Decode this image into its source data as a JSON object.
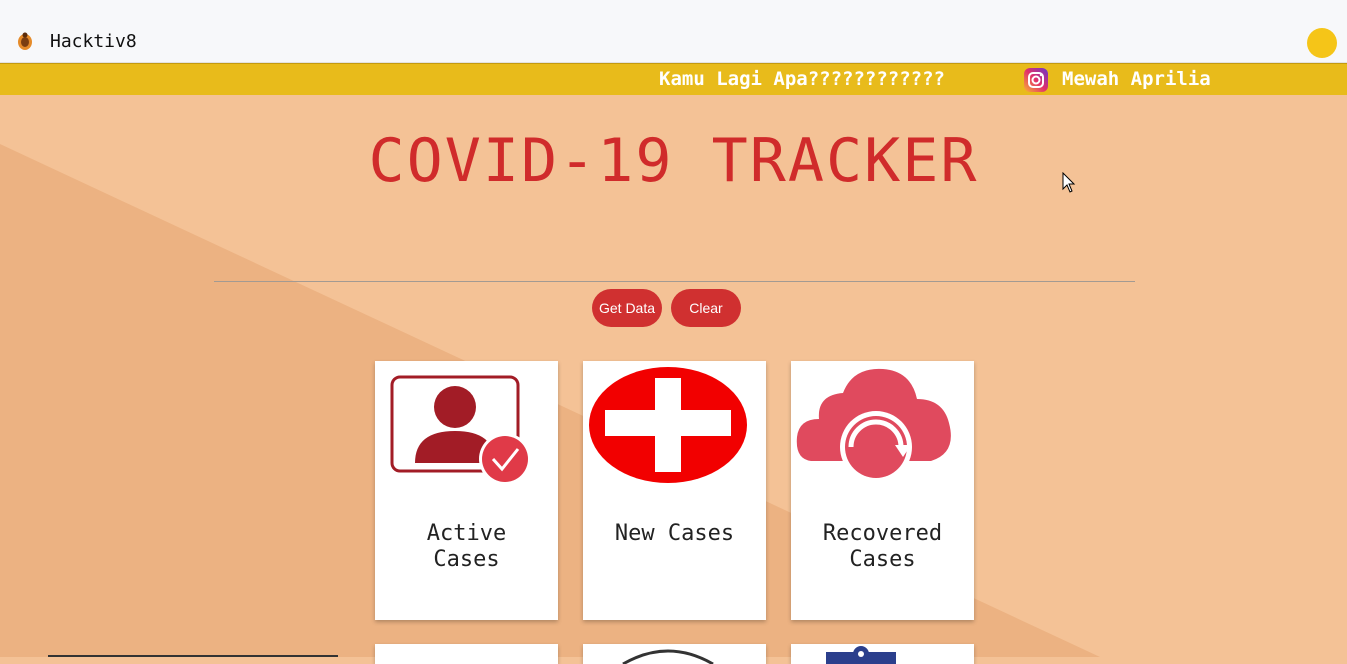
{
  "navbar": {
    "brand": "Hacktiv8"
  },
  "marquee": {
    "text": "Kamu Lagi Apa????????????",
    "instagram_name": "Mewah Aprilia"
  },
  "main": {
    "title": "COVID-19 TRACKER",
    "buttons": {
      "get_data": "Get Data",
      "clear": "Clear"
    },
    "cards": [
      {
        "label_line1": "Active",
        "label_line2": "Cases",
        "icon": "user-check-icon"
      },
      {
        "label_line1": "New Cases",
        "label_line2": "",
        "icon": "red-cross-icon"
      },
      {
        "label_line1": "Recovered",
        "label_line2": "Cases",
        "icon": "cloud-recover-icon"
      }
    ]
  },
  "colors": {
    "accent_red": "#d03030",
    "banner_yellow": "#e8bb1b",
    "background_peach": "#f4c296"
  }
}
